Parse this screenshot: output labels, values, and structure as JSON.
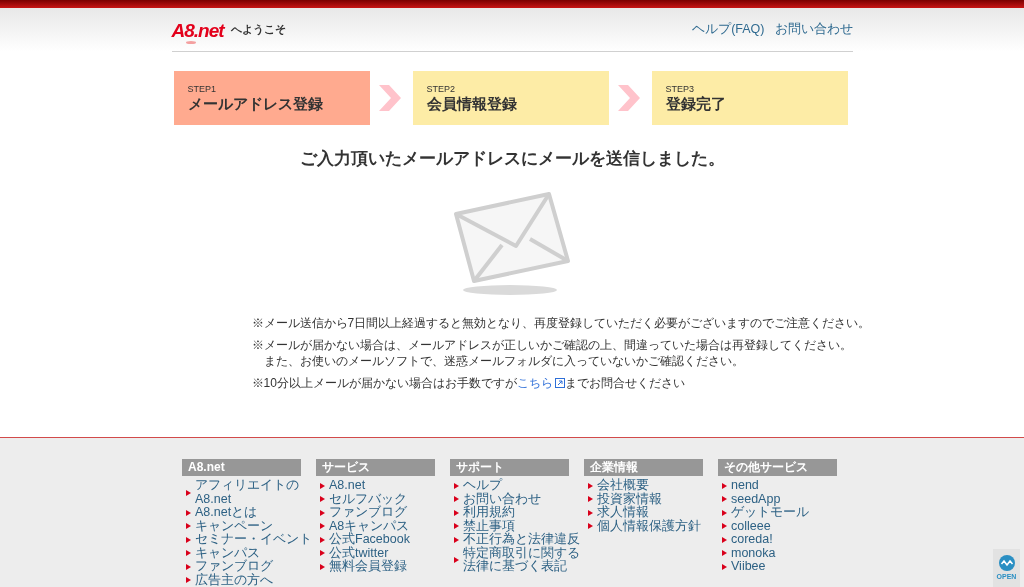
{
  "header": {
    "logo": "A8.net",
    "welcome": "へようこそ",
    "links": [
      "ヘルプ(FAQ)",
      "お問い合わせ"
    ]
  },
  "steps": [
    {
      "label": "STEP1",
      "title": "メールアドレス登録",
      "selected": true
    },
    {
      "label": "STEP2",
      "title": "会員情報登録",
      "selected": false
    },
    {
      "label": "STEP3",
      "title": "登録完了",
      "selected": false
    }
  ],
  "message": "ご入力頂いたメールアドレスにメールを送信しました。",
  "notes": [
    {
      "kind": "plain",
      "lines": [
        "※メール送信から7日間以上経過すると無効となり、再度登録していただく必要がございますのでご注意ください。"
      ]
    },
    {
      "kind": "plain",
      "lines": [
        "※メールが届かない場合は、メールアドレスが正しいかご確認の上、間違っていた場合は再登録してください。",
        "また、お使いのメールソフトで、迷惑メールフォルダに入っていないかご確認ください。"
      ]
    },
    {
      "kind": "link",
      "before": "※10分以上メールが届かない場合はお手数ですが",
      "link": "こちら",
      "after": "までお問合せください"
    }
  ],
  "footer": {
    "columns": [
      {
        "heading": "A8.net",
        "links": [
          "アフィリエイトのA8.net",
          "A8.netとは",
          "キャンペーン",
          "セミナー・イベント",
          "キャンパス",
          "ファンブログ",
          "広告主の方へ"
        ]
      },
      {
        "heading": "サービス",
        "links": [
          "A8.net",
          "セルフバック",
          "ファンブログ",
          "A8キャンパス",
          "公式Facebook",
          "公式twitter",
          "無料会員登録"
        ]
      },
      {
        "heading": "サポート",
        "links": [
          "ヘルプ",
          "お問い合わせ",
          "利用規約",
          "禁止事項",
          "不正行為と法律違反",
          "特定商取引に関する法律に基づく表記"
        ]
      },
      {
        "heading": "企業情報",
        "links": [
          "会社概要",
          "投資家情報",
          "求人情報",
          "個人情報保護方針"
        ]
      },
      {
        "heading": "その他サービス",
        "links": [
          "nend",
          "seedApp",
          "ゲットモール",
          "colleee",
          "coreda!",
          "monoka",
          "Viibee"
        ]
      }
    ]
  },
  "open_widget": {
    "label": "OPEN"
  }
}
